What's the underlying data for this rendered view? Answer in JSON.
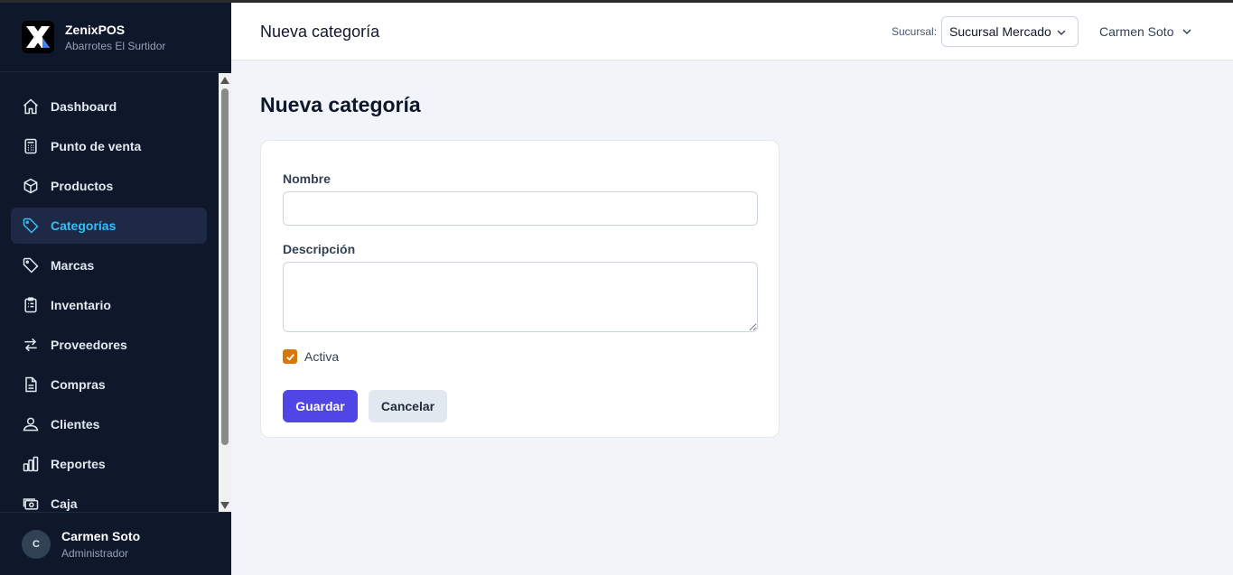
{
  "brand": {
    "name": "ZenixPOS",
    "subtitle": "Abarrotes El Surtidor"
  },
  "sidebar": {
    "items": [
      {
        "label": "Dashboard",
        "icon": "home-icon"
      },
      {
        "label": "Punto de venta",
        "icon": "calculator-icon"
      },
      {
        "label": "Productos",
        "icon": "cube-icon"
      },
      {
        "label": "Categorías",
        "icon": "tag-icon",
        "active": true
      },
      {
        "label": "Marcas",
        "icon": "tag-icon"
      },
      {
        "label": "Inventario",
        "icon": "clipboard-icon"
      },
      {
        "label": "Proveedores",
        "icon": "arrows-swap-icon"
      },
      {
        "label": "Compras",
        "icon": "document-icon"
      },
      {
        "label": "Clientes",
        "icon": "user-icon"
      },
      {
        "label": "Reportes",
        "icon": "bar-chart-icon"
      },
      {
        "label": "Caja",
        "icon": "cash-icon"
      }
    ]
  },
  "user": {
    "initial": "C",
    "name": "Carmen Soto",
    "role": "Administrador"
  },
  "header": {
    "title": "Nueva categoría",
    "branch_label": "Sucursal:",
    "branch_value": "Sucursal Mercado",
    "user_menu": "Carmen Soto"
  },
  "main": {
    "title": "Nueva categoría",
    "form": {
      "name_label": "Nombre",
      "name_value": "",
      "description_label": "Descripción",
      "description_value": "",
      "active_label": "Activa",
      "active_checked": true,
      "save_label": "Guardar",
      "cancel_label": "Cancelar"
    }
  },
  "colors": {
    "sidebar_bg": "#0f172a",
    "active_text": "#38bdf8",
    "primary_button": "#4f46e5",
    "checkbox": "#d97706"
  }
}
